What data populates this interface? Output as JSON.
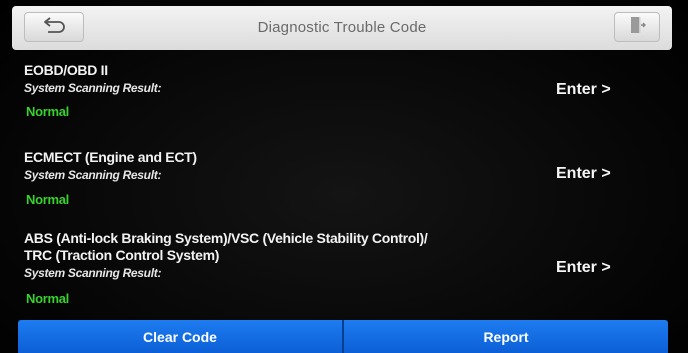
{
  "header": {
    "title": "Diagnostic Trouble Code",
    "back_icon": "back-arrow-icon",
    "exit_icon": "exit-door-icon"
  },
  "systems": [
    {
      "title_lines": [
        "EOBD/OBD II"
      ],
      "scan_label": "System Scanning Result:",
      "status": "Normal",
      "enter_label": "Enter >"
    },
    {
      "title_lines": [
        "ECMECT (Engine and ECT)"
      ],
      "scan_label": "System Scanning Result:",
      "status": "Normal",
      "enter_label": "Enter >"
    },
    {
      "title_lines": [
        "ABS (Anti-lock Braking System)/VSC (Vehicle Stability Control)/",
        "TRC (Traction Control System)"
      ],
      "scan_label": "System Scanning Result:",
      "status": "Normal",
      "enter_label": "Enter >"
    }
  ],
  "footer": {
    "clear_code_label": "Clear Code",
    "report_label": "Report"
  },
  "colors": {
    "status_normal": "#38d12e",
    "button_blue": "#1e7cf0"
  }
}
